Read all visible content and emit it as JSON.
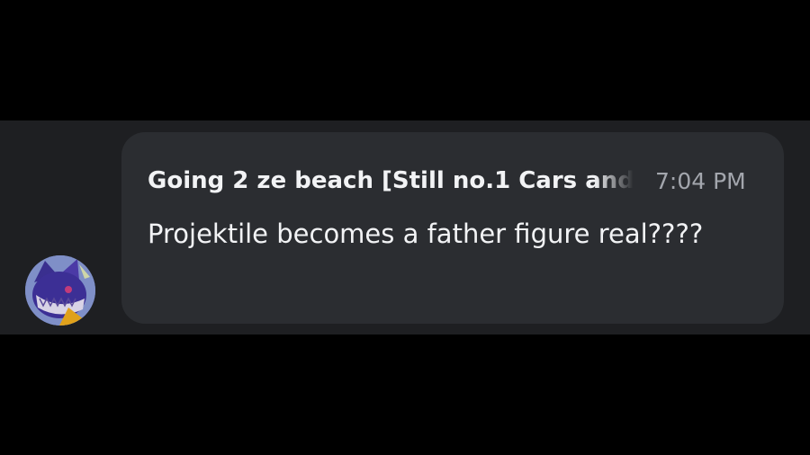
{
  "message": {
    "author": "Going 2 ze beach [Still no.1 Cars and",
    "timestamp": "7:04 PM",
    "text": "Projektile becomes a father figure real????"
  },
  "avatar": {
    "icon": "character-avatar-icon"
  },
  "colors": {
    "background": "#000000",
    "strip": "#1e1f22",
    "bubble": "#2b2d31",
    "author_text": "#f2f3f5",
    "timestamp_text": "#a3a6ad",
    "message_text": "#f2f3f5"
  }
}
